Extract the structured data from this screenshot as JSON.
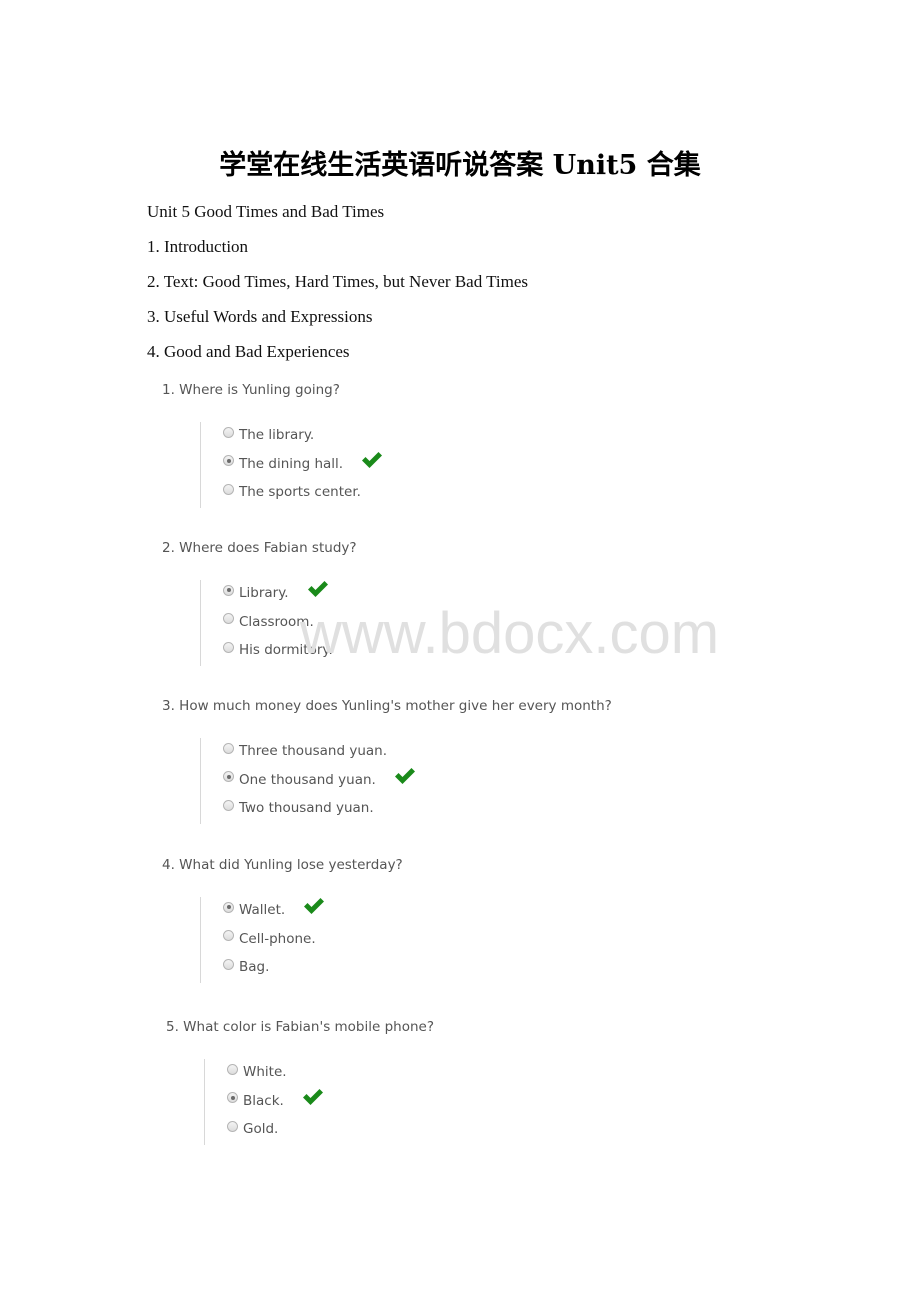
{
  "document": {
    "title": "学堂在线生活英语听说答案 Unit5 合集",
    "paragraphs": [
      "Unit 5 Good Times and Bad Times",
      "1. Introduction",
      "2. Text: Good Times, Hard Times, but Never Bad Times",
      "3. Useful Words and Expressions",
      "4. Good and Bad Experiences"
    ]
  },
  "quiz": {
    "check_color": "#1a8a1a",
    "questions": [
      {
        "question": "1. Where is Yunling going?",
        "options": [
          {
            "label": "The library.",
            "selected": false,
            "correct": false
          },
          {
            "label": "The dining hall.",
            "selected": true,
            "correct": true
          },
          {
            "label": "The sports center.",
            "selected": false,
            "correct": false
          }
        ]
      },
      {
        "question": "2. Where does Fabian study?",
        "options": [
          {
            "label": "Library.",
            "selected": true,
            "correct": true
          },
          {
            "label": "Classroom.",
            "selected": false,
            "correct": false
          },
          {
            "label": "His dormitory.",
            "selected": false,
            "correct": false
          }
        ]
      },
      {
        "question": "3. How much money does Yunling's mother give her every month?",
        "options": [
          {
            "label": "Three thousand yuan.",
            "selected": false,
            "correct": false
          },
          {
            "label": "One thousand yuan.",
            "selected": true,
            "correct": true
          },
          {
            "label": "Two thousand yuan.",
            "selected": false,
            "correct": false
          }
        ]
      },
      {
        "question": "4. What did Yunling lose yesterday?",
        "options": [
          {
            "label": "Wallet.",
            "selected": true,
            "correct": true
          },
          {
            "label": "Cell-phone.",
            "selected": false,
            "correct": false
          },
          {
            "label": "Bag.",
            "selected": false,
            "correct": false
          }
        ]
      },
      {
        "question": "5. What color is Fabian's mobile phone?",
        "options": [
          {
            "label": "White.",
            "selected": false,
            "correct": false
          },
          {
            "label": "Black.",
            "selected": true,
            "correct": true
          },
          {
            "label": "Gold.",
            "selected": false,
            "correct": false
          }
        ]
      }
    ]
  },
  "watermark": "www.bdocx.com"
}
